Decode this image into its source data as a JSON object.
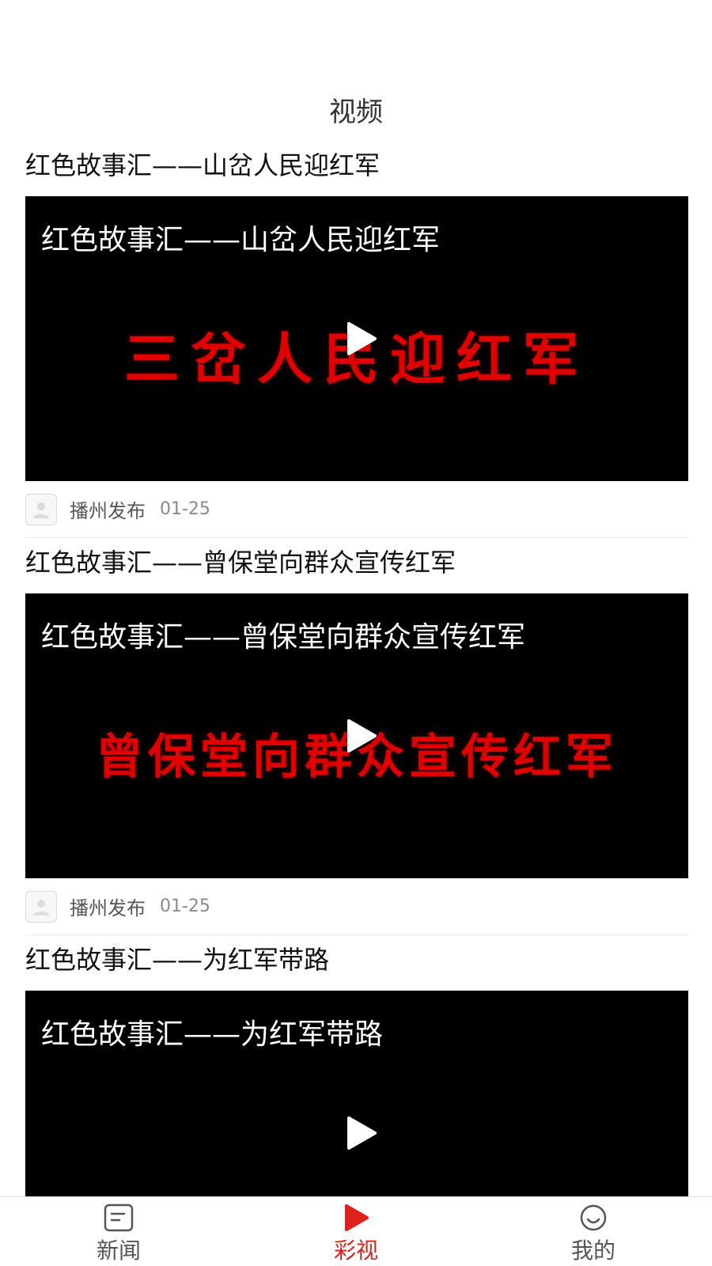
{
  "header": {
    "title": "视频"
  },
  "items": [
    {
      "title": "红色故事汇——山岔人民迎红军",
      "overlay_title": "红色故事汇——山岔人民迎红军",
      "frame_text": "三岔人民迎红军",
      "source": "播州发布",
      "date": "01-25"
    },
    {
      "title": "红色故事汇——曾保堂向群众宣传红军",
      "overlay_title": "红色故事汇——曾保堂向群众宣传红军",
      "frame_text": "曾保堂向群众宣传红军",
      "source": "播州发布",
      "date": "01-25"
    },
    {
      "title": "红色故事汇——为红军带路",
      "overlay_title": "红色故事汇——为红军带路",
      "frame_text": "",
      "source": "",
      "date": ""
    }
  ],
  "tabbar": {
    "tabs": [
      {
        "label": "新闻",
        "icon": "news-icon",
        "active": false
      },
      {
        "label": "彩视",
        "icon": "play-icon",
        "active": true
      },
      {
        "label": "我的",
        "icon": "smile-icon",
        "active": false
      }
    ],
    "active_color": "#e0211b",
    "inactive_color": "#555555"
  }
}
